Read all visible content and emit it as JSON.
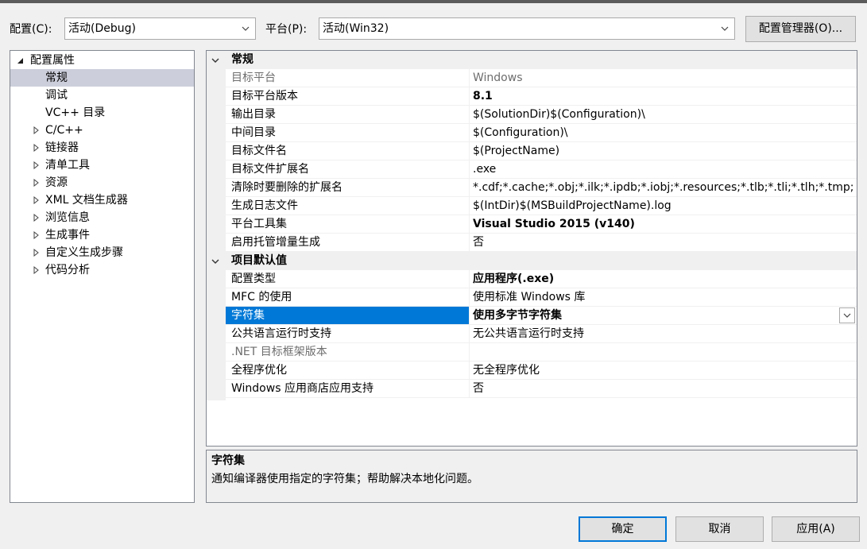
{
  "toolbar": {
    "config_label": "配置(C):",
    "config_value": "活动(Debug)",
    "platform_label": "平台(P):",
    "platform_value": "活动(Win32)",
    "config_manager_button": "配置管理器(O)..."
  },
  "tree": {
    "root": "配置属性",
    "items": [
      {
        "label": "常规",
        "expandable": false,
        "selected": true
      },
      {
        "label": "调试",
        "expandable": false
      },
      {
        "label": "VC++ 目录",
        "expandable": false
      },
      {
        "label": "C/C++",
        "expandable": true
      },
      {
        "label": "链接器",
        "expandable": true
      },
      {
        "label": "清单工具",
        "expandable": true
      },
      {
        "label": "资源",
        "expandable": true
      },
      {
        "label": "XML 文档生成器",
        "expandable": true
      },
      {
        "label": "浏览信息",
        "expandable": true
      },
      {
        "label": "生成事件",
        "expandable": true
      },
      {
        "label": "自定义生成步骤",
        "expandable": true
      },
      {
        "label": "代码分析",
        "expandable": true
      }
    ]
  },
  "grid": {
    "categories": [
      {
        "title": "常规",
        "rows": [
          {
            "name": "目标平台",
            "value": "Windows",
            "dim": true
          },
          {
            "name": "目标平台版本",
            "value": "8.1",
            "bold": true
          },
          {
            "name": "输出目录",
            "value": "$(SolutionDir)$(Configuration)\\"
          },
          {
            "name": "中间目录",
            "value": "$(Configuration)\\"
          },
          {
            "name": "目标文件名",
            "value": "$(ProjectName)"
          },
          {
            "name": "目标文件扩展名",
            "value": ".exe"
          },
          {
            "name": "清除时要删除的扩展名",
            "value": "*.cdf;*.cache;*.obj;*.ilk;*.ipdb;*.iobj;*.resources;*.tlb;*.tli;*.tlh;*.tmp;"
          },
          {
            "name": "生成日志文件",
            "value": "$(IntDir)$(MSBuildProjectName).log"
          },
          {
            "name": "平台工具集",
            "value": "Visual Studio 2015 (v140)",
            "bold": true
          },
          {
            "name": "启用托管增量生成",
            "value": "否"
          }
        ]
      },
      {
        "title": "项目默认值",
        "rows": [
          {
            "name": "配置类型",
            "value": "应用程序(.exe)",
            "bold": true
          },
          {
            "name": "MFC 的使用",
            "value": "使用标准 Windows 库"
          },
          {
            "name": "字符集",
            "value": "使用多字节字符集",
            "selected": true
          },
          {
            "name": "公共语言运行时支持",
            "value": "无公共语言运行时支持"
          },
          {
            "name": ".NET 目标框架版本",
            "value": "",
            "dim": true
          },
          {
            "name": "全程序优化",
            "value": "无全程序优化"
          },
          {
            "name": "Windows 应用商店应用支持",
            "value": "否"
          }
        ]
      }
    ]
  },
  "description": {
    "title": "字符集",
    "text": "通知编译器使用指定的字符集；帮助解决本地化问题。"
  },
  "buttons": {
    "ok": "确定",
    "cancel": "取消",
    "apply": "应用(A)"
  },
  "colors": {
    "selection": "#0078d7",
    "tree_selection": "#cccedb",
    "window_bg": "#f0f0f0"
  }
}
